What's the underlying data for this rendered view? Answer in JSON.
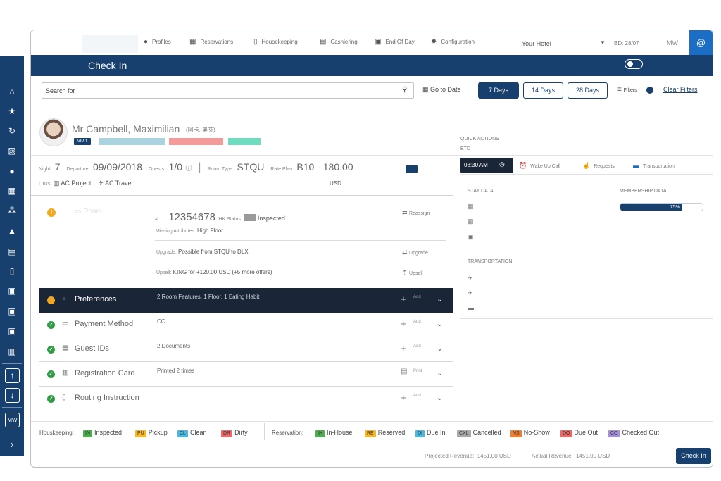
{
  "rail": {
    "icons": [
      "home-icon",
      "star-icon",
      "refresh-icon",
      "stripes-icon",
      "user-icon",
      "calendar-icon",
      "group-icon",
      "service-bell-icon",
      "calculator-icon",
      "door-key-icon",
      "clipboard-icon",
      "clipboard-check-icon",
      "clipboard-list-icon",
      "chart-icon"
    ],
    "up": "↑",
    "down": "↓",
    "user_initials": "MW",
    "expand": "›"
  },
  "topnav": {
    "items": [
      {
        "label": "Profiles",
        "icon": "person-icon"
      },
      {
        "label": "Reservations",
        "icon": "calendar-icon"
      },
      {
        "label": "Housekeeping",
        "icon": "door-icon"
      },
      {
        "label": "Cashiering",
        "icon": "calculator-icon"
      },
      {
        "label": "End Of Day",
        "icon": "clipboard-icon"
      },
      {
        "label": "Configuration",
        "icon": "gear-icon"
      }
    ],
    "hotel": "Your Hotel",
    "business_date": "BD: 28/07",
    "user": "MW",
    "at": "@"
  },
  "page": {
    "title": "Check In"
  },
  "search": {
    "placeholder": "Search for",
    "goto_date": "Go to Date",
    "ranges": [
      "7 Days",
      "14 Days",
      "28 Days"
    ],
    "active_range": "7 Days",
    "filters": "Filters",
    "clear_filters": "Clear Filters"
  },
  "guest": {
    "name": "Mr Campbell, Maximilian",
    "name_alt": "(阿卡, 奥芬)",
    "vip": "VIP 1",
    "tag_colors": [
      "#a9d3df",
      "#f29b9a",
      "#6fdcc0"
    ]
  },
  "quick_actions": {
    "title": "QUICK ACTIONS",
    "etd_label": "ETD",
    "time": "08:30 AM",
    "actions": [
      "Wake Up Call",
      "Requests",
      "Transportation"
    ]
  },
  "stay": {
    "night_label": "Night:",
    "night": "7",
    "departure_label": "Departure:",
    "departure": "09/09/2018",
    "guests_label": "Guests:",
    "guests": "1/0",
    "room_type_label": "Room Type:",
    "room_type": "STQU",
    "rate_plan_label": "Rate Plan:",
    "rate_plan": "B10 - 180.00",
    "currency": "USD",
    "links_label": "Links:",
    "link1": "AC Project",
    "link2": "AC Travel"
  },
  "room": {
    "label": "Room",
    "number_prefix": "#:",
    "number": "12354678",
    "hk_label": "HK Status:",
    "hk_status": "Inspected",
    "missing_label": "Missing Attributes:",
    "missing": "High Floor",
    "reassign": "Reassign",
    "upgrade_label": "Upgrade:",
    "upgrade_text": "Possible from STQU to DLX",
    "upgrade_action": "Upgrade",
    "upsell_label": "Upsell:",
    "upsell_text": "KING for +120.00 USD (+5 more offers)",
    "upsell_action": "Upsell"
  },
  "sections": [
    {
      "name": "Preferences",
      "detail": "2 Room Features, 1 Floor, 1 Eating Habit",
      "action": "Add",
      "status": "warn",
      "icon": "person-icon"
    },
    {
      "name": "Payment Method",
      "detail": "CC",
      "action": "Add",
      "status": "ok",
      "icon": "card-icon"
    },
    {
      "name": "Guest IDs",
      "detail": "2 Documents",
      "action": "Add",
      "status": "ok",
      "icon": "id-card-icon"
    },
    {
      "name": "Registration Card",
      "detail": "Printed 2 times",
      "action": "Print",
      "status": "ok",
      "icon": "document-icon"
    },
    {
      "name": "Routing Instruction",
      "detail": "",
      "action": "Add",
      "status": "ok",
      "icon": "routing-icon"
    }
  ],
  "right_panel": {
    "stay_data": "STAY DATA",
    "membership_data": "MEMBERSHIP DATA",
    "membership_progress": 0.75,
    "membership_label": "75%",
    "transportation": "TRANSPORTATION"
  },
  "legend": {
    "housekeeping_label": "Houskeeping:",
    "housekeeping": [
      {
        "code": "IN",
        "label": "Inspected",
        "color": "#4caf50"
      },
      {
        "code": "PU",
        "label": "Pickup",
        "color": "#f5b82e"
      },
      {
        "code": "CL",
        "label": "Clean",
        "color": "#4bb8e0"
      },
      {
        "code": "DR",
        "label": "Dirty",
        "color": "#e86a6a"
      }
    ],
    "reservation_label": "Reservation:",
    "reservation": [
      {
        "code": "IH",
        "label": "In-House",
        "color": "#4caf50"
      },
      {
        "code": "RE",
        "label": "Reserved",
        "color": "#f5b82e"
      },
      {
        "code": "DI",
        "label": "Due In",
        "color": "#4bb8e0"
      },
      {
        "code": "CXL",
        "label": "Cancelled",
        "color": "#a9a9a9"
      },
      {
        "code": "NS",
        "label": "No-Show",
        "color": "#f07f2f"
      },
      {
        "code": "DO",
        "label": "Due Out",
        "color": "#e86a6a"
      },
      {
        "code": "CO",
        "label": "Checked Out",
        "color": "#a58fd6"
      }
    ]
  },
  "footer": {
    "projected_label": "Projected Revenue:",
    "projected": "1451.00 USD",
    "actual_label": "Actual Revenue:",
    "actual": "1451.00 USD",
    "checkin_button": "Check In"
  }
}
